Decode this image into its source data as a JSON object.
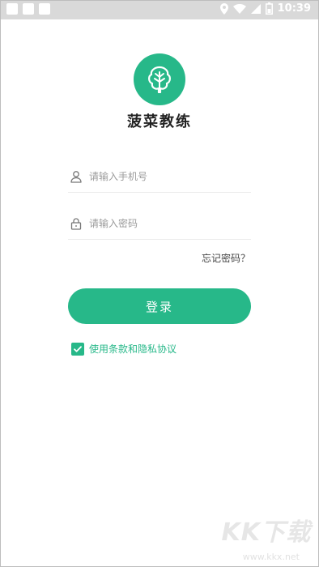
{
  "status_bar": {
    "time": "10:39",
    "icons": [
      "location-icon",
      "wifi-icon",
      "signal-icon",
      "battery-icon"
    ]
  },
  "app": {
    "name": "菠菜教练",
    "logo_icon": "leaf-icon",
    "accent_color": "#27b889"
  },
  "login_form": {
    "phone_placeholder": "请输入手机号",
    "phone_value": "",
    "password_placeholder": "请输入密码",
    "password_value": "",
    "forgot_password": "忘记密码？",
    "login_button": "登录",
    "agreement_checked": true,
    "agreement_text": "使用条款和隐私协议"
  },
  "watermark": {
    "logo": "KK下载",
    "url": "www.kkx.net"
  }
}
